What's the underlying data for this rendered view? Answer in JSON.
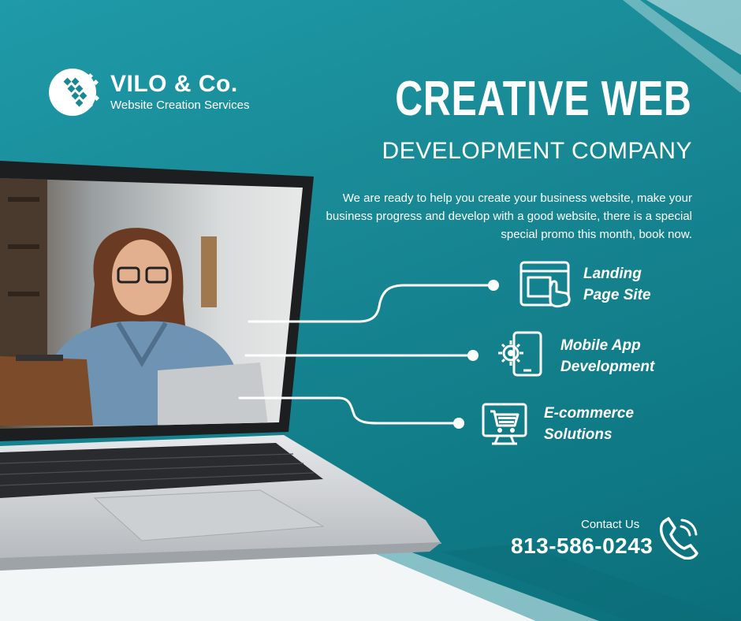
{
  "brand": {
    "name": "VILO & Co.",
    "tagline": "Website Creation Services",
    "logo_icon": "grid-globe-icon"
  },
  "headline": {
    "main": "CREATIVE WEB",
    "sub": "DEVELOPMENT COMPANY"
  },
  "description": "We are ready to help you create your business website, make your business progress and develop with a good website, there is a special special promo this month, book now.",
  "services": [
    {
      "line1": "Landing",
      "line2": "Page Site",
      "icon": "web-click-icon"
    },
    {
      "line1": "Mobile App",
      "line2": "Development",
      "icon": "mobile-gear-icon"
    },
    {
      "line1": "E-commerce",
      "line2": "Solutions",
      "icon": "shopping-cart-monitor-icon"
    }
  ],
  "contact": {
    "label": "Contact Us",
    "phone": "813-586-0243",
    "icon": "phone-ringing-icon"
  },
  "colors": {
    "teal": "#188894",
    "white": "#ffffff"
  }
}
